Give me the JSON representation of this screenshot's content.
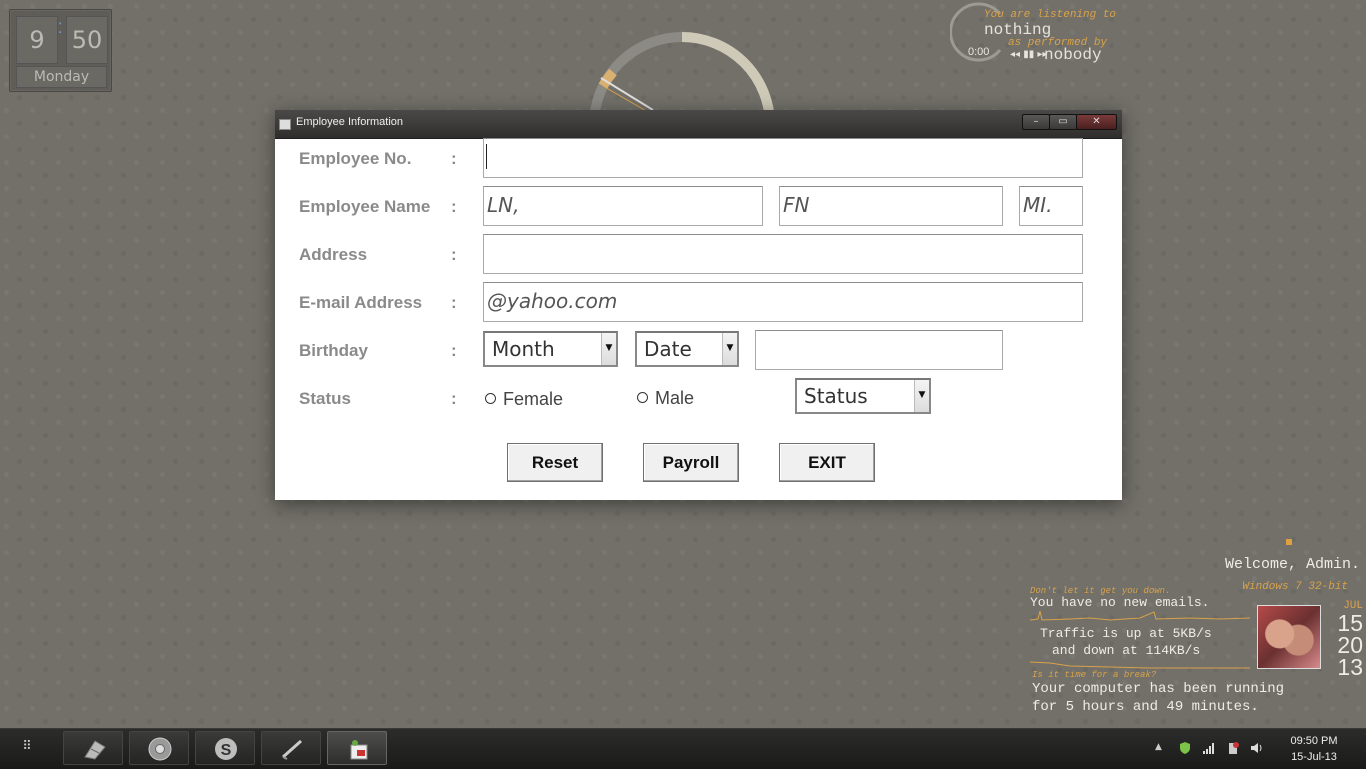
{
  "desktop": {
    "clock": {
      "hour": "9",
      "minute": "50",
      "day": "Monday"
    },
    "music": {
      "line1": "You are listening to",
      "track": "nothing",
      "line3": "as performed by",
      "artist": "nobody",
      "time": "0:00",
      "controls": "◂◂ ▮▮ ▸▸"
    },
    "system": {
      "welcome": "Welcome, Admin.",
      "os": "Windows 7 32-bit",
      "tip": "Don't let it get you down.",
      "mail": "You have no new emails.",
      "traffic_line1": "Traffic is up at 5KB/s",
      "traffic_line2": "and down at 114KB/s",
      "break": "Is it time for a break?",
      "uptime_line1": "Your computer has been running",
      "uptime_line2": "for 5 hours and 49 minutes."
    },
    "date": {
      "month": "JUL",
      "day": "15",
      "year1": "20",
      "year2": "13"
    }
  },
  "window": {
    "title": "Employee Information",
    "controls": {
      "minimize": "–",
      "maximize": "▭",
      "close": "✕"
    },
    "labels": {
      "employee_no": "Employee No.",
      "employee_name": "Employee Name",
      "address": "Address",
      "email": "E-mail Address",
      "birthday": "Birthday",
      "status": "Status",
      "colon": ":"
    },
    "fields": {
      "employee_no": "",
      "last_name": "LN,",
      "first_name": "FN",
      "middle_initial": "MI.",
      "address": "",
      "email": "@yahoo.com",
      "year": ""
    },
    "combos": {
      "month": "Month",
      "date": "Date",
      "status": "Status",
      "arrow": "▼"
    },
    "radios": {
      "female": "Female",
      "male": "Male"
    },
    "buttons": {
      "reset": "Reset",
      "payroll": "Payroll",
      "exit": "EXIT"
    }
  },
  "taskbar": {
    "time": "09:50 PM",
    "date": "15-Jul-13",
    "start": "⠿"
  }
}
